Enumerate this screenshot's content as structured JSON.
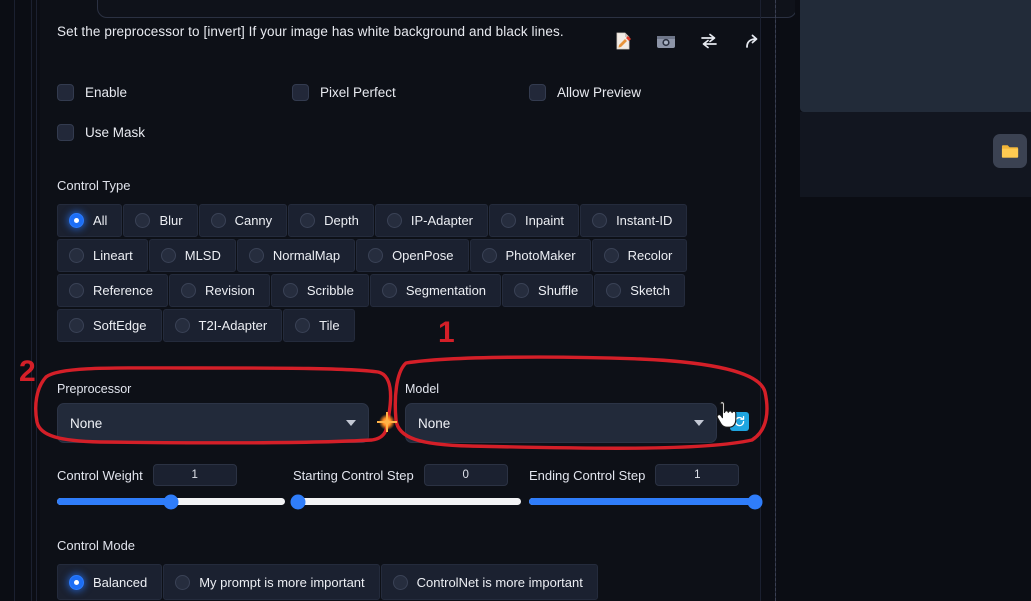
{
  "hint": {
    "text": "Set the preprocessor to [invert] If your image has white background and black lines."
  },
  "toolbar_icons": [
    {
      "name": "edit-image-icon",
      "glyph": "edit"
    },
    {
      "name": "camera-icon",
      "glyph": "camera"
    },
    {
      "name": "swap-icon",
      "glyph": "swap"
    },
    {
      "name": "send-arrow-icon",
      "glyph": "arrow"
    }
  ],
  "checkboxes": [
    {
      "label": "Enable",
      "checked": false
    },
    {
      "label": "Pixel Perfect",
      "checked": false
    },
    {
      "label": "Allow Preview",
      "checked": false
    },
    {
      "label": "Use Mask",
      "checked": false
    }
  ],
  "control_type": {
    "heading": "Control Type",
    "selected": "All",
    "rows": [
      [
        "All",
        "Blur",
        "Canny",
        "Depth",
        "IP-Adapter",
        "Inpaint",
        "Instant-ID"
      ],
      [
        "Lineart",
        "MLSD",
        "NormalMap",
        "OpenPose",
        "PhotoMaker",
        "Recolor"
      ],
      [
        "Reference",
        "Revision",
        "Scribble",
        "Segmentation",
        "Shuffle",
        "Sketch"
      ],
      [
        "SoftEdge",
        "T2I-Adapter",
        "Tile"
      ]
    ]
  },
  "preprocessor": {
    "label": "Preprocessor",
    "value": "None"
  },
  "model": {
    "label": "Model",
    "value": "None",
    "refresh_icon": "refresh-icon"
  },
  "sliders": [
    {
      "name": "Control Weight",
      "value": "1",
      "fill_pct": 50
    },
    {
      "name": "Starting Control Step",
      "value": "0",
      "fill_pct": 0
    },
    {
      "name": "Ending Control Step",
      "value": "1",
      "fill_pct": 100
    }
  ],
  "control_mode": {
    "heading": "Control Mode",
    "selected": "Balanced",
    "options": [
      "Balanced",
      "My prompt is more important",
      "ControlNet is more important"
    ]
  },
  "right_panel": {
    "folder_button_icon": "folder-icon"
  },
  "annotations": {
    "marker_one": "1",
    "marker_two": "2",
    "color": "#d41f28"
  },
  "colors": {
    "accent_blue": "#2f7dfa",
    "annotation_red": "#d41f28",
    "refresh_cyan": "#1fa5e0",
    "folder_yellow": "#f2b537",
    "page_bg": "#0b0d14",
    "panel_bg": "#0d1017"
  }
}
